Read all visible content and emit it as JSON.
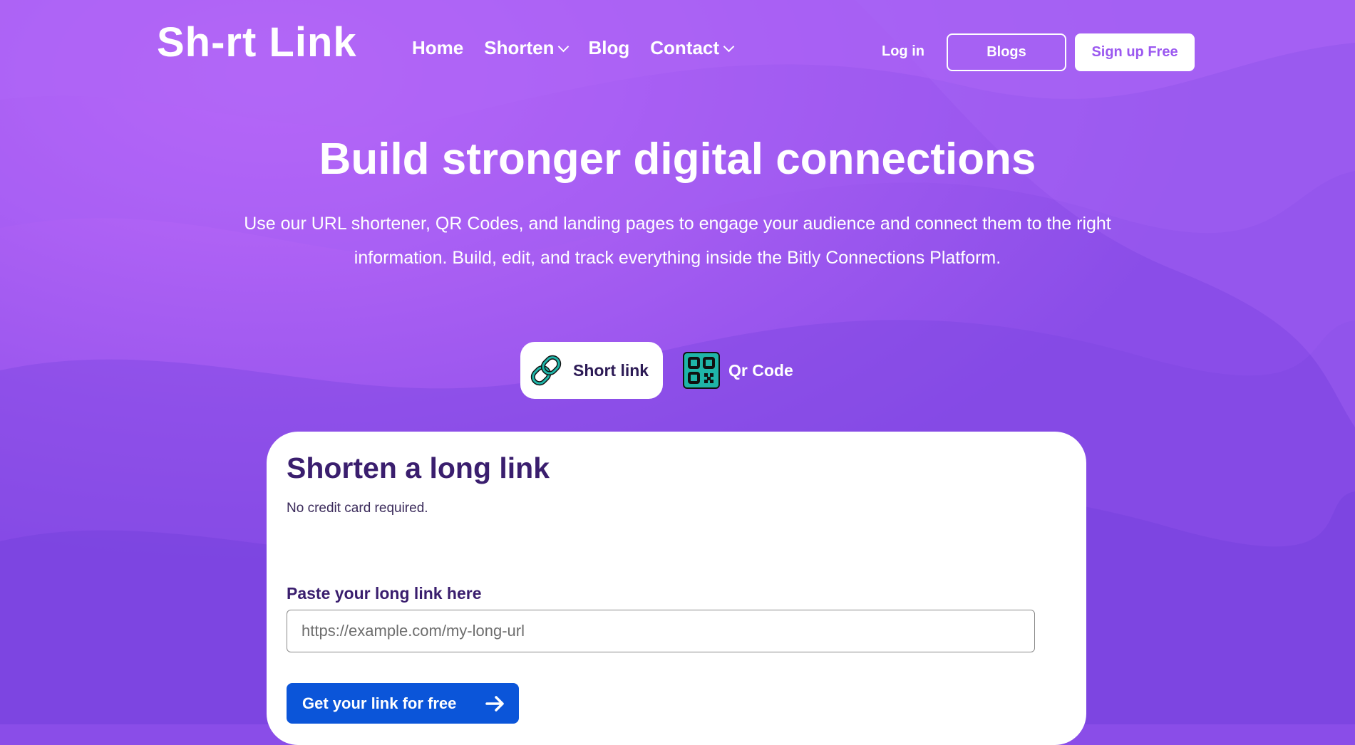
{
  "header": {
    "logo": "Sh-rt Link",
    "nav": [
      {
        "label": "Home",
        "dropdown": false
      },
      {
        "label": "Shorten",
        "dropdown": true
      },
      {
        "label": "Blog",
        "dropdown": false
      },
      {
        "label": "Contact",
        "dropdown": true
      }
    ],
    "login_label": "Log in",
    "blogs_label": "Blogs",
    "signup_label": "Sign up Free"
  },
  "hero": {
    "title": "Build stronger digital connections",
    "subtitle": "Use our URL shortener, QR Codes, and landing pages to engage your audience and connect them to the right information. Build, edit, and track everything inside the Bitly Connections Platform."
  },
  "tabs": [
    {
      "label": "Short link",
      "icon": "chain-link-icon",
      "active": true
    },
    {
      "label": "Qr Code",
      "icon": "qr-code-icon",
      "active": false
    }
  ],
  "card": {
    "title": "Shorten a long link",
    "subtitle": "No credit card required.",
    "field_label": "Paste your long link here",
    "input_value": "",
    "input_placeholder": "https://example.com/my-long-url",
    "cta_label": "Get your link for free",
    "cta_icon": "arrow-right-icon"
  },
  "colors": {
    "background": "#8a4de8",
    "accent_cta": "#0b55d9",
    "heading_purple": "#3a1e6e",
    "signup_text": "#9b58f0",
    "icon_teal": "#1fb5a8"
  }
}
